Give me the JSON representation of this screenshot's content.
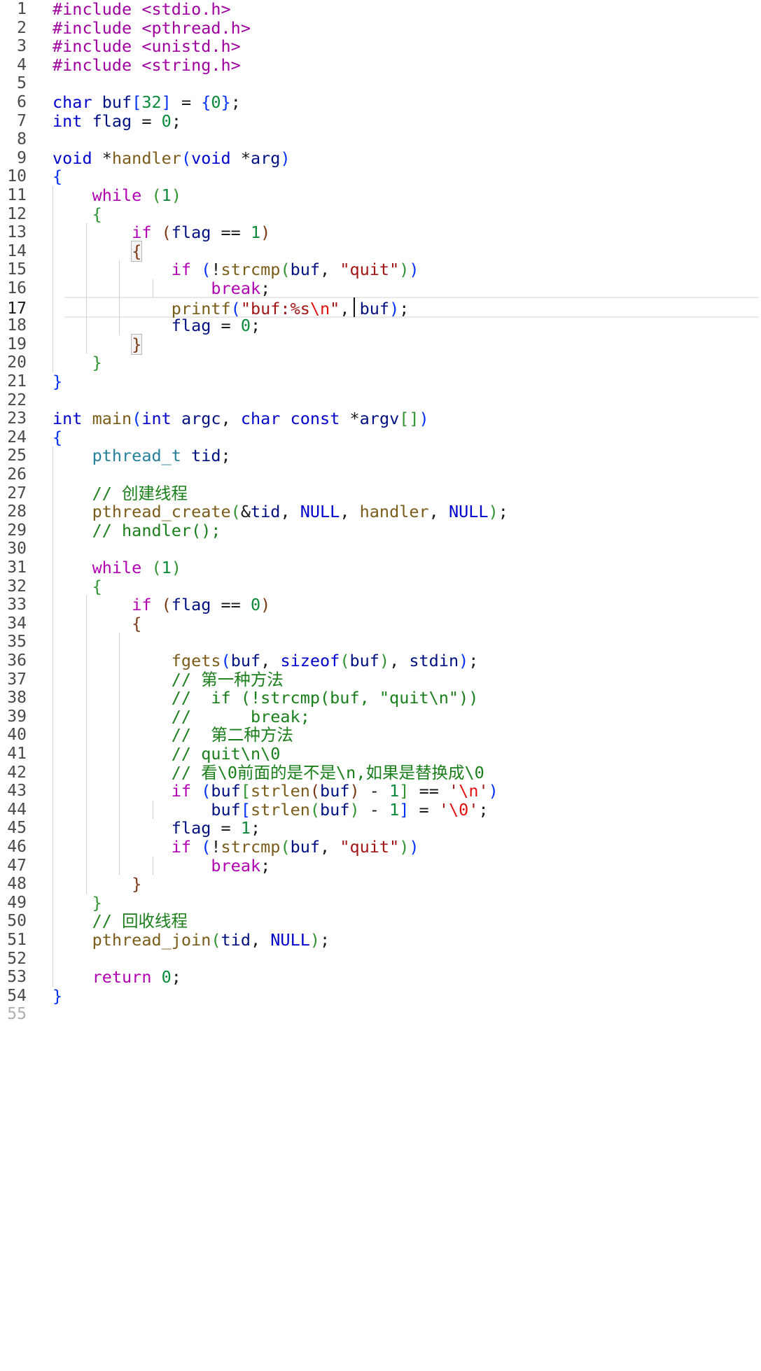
{
  "editor": {
    "language": "c",
    "current_line": 17,
    "lines": [
      {
        "n": "1",
        "t": [
          [
            "pp",
            "#include <stdio.h>"
          ]
        ]
      },
      {
        "n": "2",
        "t": [
          [
            "pp",
            "#include <pthread.h>"
          ]
        ]
      },
      {
        "n": "3",
        "t": [
          [
            "pp",
            "#include <unistd.h>"
          ]
        ]
      },
      {
        "n": "4",
        "t": [
          [
            "pp",
            "#include <string.h>"
          ]
        ]
      },
      {
        "n": "5",
        "t": []
      },
      {
        "n": "6",
        "t": [
          [
            "kw",
            "char"
          ],
          [
            "op",
            " "
          ],
          [
            "id",
            "buf"
          ],
          [
            "p1",
            "["
          ],
          [
            "num",
            "32"
          ],
          [
            "p1",
            "]"
          ],
          [
            "op",
            " = "
          ],
          [
            "p1",
            "{"
          ],
          [
            "num",
            "0"
          ],
          [
            "p1",
            "}"
          ],
          [
            "op",
            ";"
          ]
        ]
      },
      {
        "n": "7",
        "t": [
          [
            "kw",
            "int"
          ],
          [
            "op",
            " "
          ],
          [
            "id",
            "flag"
          ],
          [
            "op",
            " = "
          ],
          [
            "num",
            "0"
          ],
          [
            "op",
            ";"
          ]
        ]
      },
      {
        "n": "8",
        "t": []
      },
      {
        "n": "9",
        "t": [
          [
            "kw",
            "void"
          ],
          [
            "op",
            " *"
          ],
          [
            "fn",
            "handler"
          ],
          [
            "p1",
            "("
          ],
          [
            "kw",
            "void"
          ],
          [
            "op",
            " *"
          ],
          [
            "id",
            "arg"
          ],
          [
            "p1",
            ")"
          ]
        ]
      },
      {
        "n": "10",
        "t": [
          [
            "p1",
            "{"
          ]
        ]
      },
      {
        "n": "11",
        "t": [
          [
            "op",
            "    "
          ],
          [
            "ctl",
            "while"
          ],
          [
            "op",
            " "
          ],
          [
            "p2",
            "("
          ],
          [
            "num",
            "1"
          ],
          [
            "p2",
            ")"
          ]
        ]
      },
      {
        "n": "12",
        "t": [
          [
            "op",
            "    "
          ],
          [
            "p2",
            "{"
          ]
        ]
      },
      {
        "n": "13",
        "t": [
          [
            "op",
            "        "
          ],
          [
            "ctl",
            "if"
          ],
          [
            "op",
            " "
          ],
          [
            "p3",
            "("
          ],
          [
            "id",
            "flag"
          ],
          [
            "op",
            " == "
          ],
          [
            "num",
            "1"
          ],
          [
            "p3",
            ")"
          ]
        ]
      },
      {
        "n": "14",
        "t": [
          [
            "op",
            "        "
          ],
          [
            "p3b",
            "{"
          ]
        ]
      },
      {
        "n": "15",
        "t": [
          [
            "op",
            "            "
          ],
          [
            "ctl",
            "if"
          ],
          [
            "op",
            " "
          ],
          [
            "p1",
            "("
          ],
          [
            "op",
            "!"
          ],
          [
            "fn",
            "strcmp"
          ],
          [
            "p2",
            "("
          ],
          [
            "id",
            "buf"
          ],
          [
            "op",
            ", "
          ],
          [
            "str",
            "\"quit\""
          ],
          [
            "p2",
            ")"
          ],
          [
            "p1",
            ")"
          ]
        ]
      },
      {
        "n": "16",
        "t": [
          [
            "op",
            "                "
          ],
          [
            "ctl",
            "break"
          ],
          [
            "op",
            ";"
          ]
        ]
      },
      {
        "n": "17",
        "t": [
          [
            "op",
            "            "
          ],
          [
            "fn",
            "printf"
          ],
          [
            "p1",
            "("
          ],
          [
            "str",
            "\"buf:%s"
          ],
          [
            "esc",
            "\\n"
          ],
          [
            "str",
            "\""
          ],
          [
            "op",
            ", "
          ],
          [
            "id",
            "buf"
          ],
          [
            "p1",
            ")"
          ],
          [
            "op",
            ";"
          ]
        ]
      },
      {
        "n": "18",
        "t": [
          [
            "op",
            "            "
          ],
          [
            "id",
            "flag"
          ],
          [
            "op",
            " = "
          ],
          [
            "num",
            "0"
          ],
          [
            "op",
            ";"
          ]
        ]
      },
      {
        "n": "19",
        "t": [
          [
            "op",
            "        "
          ],
          [
            "p3b",
            "}"
          ]
        ]
      },
      {
        "n": "20",
        "t": [
          [
            "op",
            "    "
          ],
          [
            "p2",
            "}"
          ]
        ]
      },
      {
        "n": "21",
        "t": [
          [
            "p1",
            "}"
          ]
        ]
      },
      {
        "n": "22",
        "t": []
      },
      {
        "n": "23",
        "t": [
          [
            "kw",
            "int"
          ],
          [
            "op",
            " "
          ],
          [
            "fn",
            "main"
          ],
          [
            "p1",
            "("
          ],
          [
            "kw",
            "int"
          ],
          [
            "op",
            " "
          ],
          [
            "id",
            "argc"
          ],
          [
            "op",
            ", "
          ],
          [
            "kw",
            "char"
          ],
          [
            "op",
            " "
          ],
          [
            "kw",
            "const"
          ],
          [
            "op",
            " *"
          ],
          [
            "id",
            "argv"
          ],
          [
            "p2",
            "[]"
          ],
          [
            "p1",
            ")"
          ]
        ]
      },
      {
        "n": "24",
        "t": [
          [
            "p1",
            "{"
          ]
        ]
      },
      {
        "n": "25",
        "t": [
          [
            "op",
            "    "
          ],
          [
            "ty",
            "pthread_t"
          ],
          [
            "op",
            " "
          ],
          [
            "id",
            "tid"
          ],
          [
            "op",
            ";"
          ]
        ]
      },
      {
        "n": "26",
        "t": []
      },
      {
        "n": "27",
        "t": [
          [
            "op",
            "    "
          ],
          [
            "cm",
            "// 创建线程"
          ]
        ]
      },
      {
        "n": "28",
        "t": [
          [
            "op",
            "    "
          ],
          [
            "fn",
            "pthread_create"
          ],
          [
            "p2",
            "("
          ],
          [
            "op",
            "&"
          ],
          [
            "id",
            "tid"
          ],
          [
            "op",
            ", "
          ],
          [
            "kw",
            "NULL"
          ],
          [
            "op",
            ", "
          ],
          [
            "fn",
            "handler"
          ],
          [
            "op",
            ", "
          ],
          [
            "kw",
            "NULL"
          ],
          [
            "p2",
            ")"
          ],
          [
            "op",
            ";"
          ]
        ]
      },
      {
        "n": "29",
        "t": [
          [
            "op",
            "    "
          ],
          [
            "cm",
            "// handler();"
          ]
        ]
      },
      {
        "n": "30",
        "t": []
      },
      {
        "n": "31",
        "t": [
          [
            "op",
            "    "
          ],
          [
            "ctl",
            "while"
          ],
          [
            "op",
            " "
          ],
          [
            "p2",
            "("
          ],
          [
            "num",
            "1"
          ],
          [
            "p2",
            ")"
          ]
        ]
      },
      {
        "n": "32",
        "t": [
          [
            "op",
            "    "
          ],
          [
            "p2",
            "{"
          ]
        ]
      },
      {
        "n": "33",
        "t": [
          [
            "op",
            "        "
          ],
          [
            "ctl",
            "if"
          ],
          [
            "op",
            " "
          ],
          [
            "p3",
            "("
          ],
          [
            "id",
            "flag"
          ],
          [
            "op",
            " == "
          ],
          [
            "num",
            "0"
          ],
          [
            "p3",
            ")"
          ]
        ]
      },
      {
        "n": "34",
        "t": [
          [
            "op",
            "        "
          ],
          [
            "p3",
            "{"
          ]
        ]
      },
      {
        "n": "35",
        "t": []
      },
      {
        "n": "36",
        "t": [
          [
            "op",
            "            "
          ],
          [
            "fn",
            "fgets"
          ],
          [
            "p1",
            "("
          ],
          [
            "id",
            "buf"
          ],
          [
            "op",
            ", "
          ],
          [
            "kw",
            "sizeof"
          ],
          [
            "p2",
            "("
          ],
          [
            "id",
            "buf"
          ],
          [
            "p2",
            ")"
          ],
          [
            "op",
            ", "
          ],
          [
            "id",
            "stdin"
          ],
          [
            "p1",
            ")"
          ],
          [
            "op",
            ";"
          ]
        ]
      },
      {
        "n": "37",
        "t": [
          [
            "op",
            "            "
          ],
          [
            "cm",
            "// 第一种方法"
          ]
        ]
      },
      {
        "n": "38",
        "t": [
          [
            "op",
            "            "
          ],
          [
            "cm",
            "//  if (!strcmp(buf, \"quit\\n\"))"
          ]
        ]
      },
      {
        "n": "39",
        "t": [
          [
            "op",
            "            "
          ],
          [
            "cm",
            "//      break;"
          ]
        ]
      },
      {
        "n": "40",
        "t": [
          [
            "op",
            "            "
          ],
          [
            "cm",
            "//  第二种方法"
          ]
        ]
      },
      {
        "n": "41",
        "t": [
          [
            "op",
            "            "
          ],
          [
            "cm",
            "// quit\\n\\0"
          ]
        ]
      },
      {
        "n": "42",
        "t": [
          [
            "op",
            "            "
          ],
          [
            "cm",
            "// 看\\0前面的是不是\\n,如果是替换成\\0"
          ]
        ]
      },
      {
        "n": "43",
        "t": [
          [
            "op",
            "            "
          ],
          [
            "ctl",
            "if"
          ],
          [
            "op",
            " "
          ],
          [
            "p1",
            "("
          ],
          [
            "id",
            "buf"
          ],
          [
            "p2",
            "["
          ],
          [
            "fn",
            "strlen"
          ],
          [
            "p3",
            "("
          ],
          [
            "id",
            "buf"
          ],
          [
            "p3",
            ")"
          ],
          [
            "op",
            " - "
          ],
          [
            "num",
            "1"
          ],
          [
            "p2",
            "]"
          ],
          [
            "op",
            " == "
          ],
          [
            "str",
            "'"
          ],
          [
            "esc",
            "\\n"
          ],
          [
            "str",
            "'"
          ],
          [
            "p1",
            ")"
          ]
        ]
      },
      {
        "n": "44",
        "t": [
          [
            "op",
            "                "
          ],
          [
            "id",
            "buf"
          ],
          [
            "p1",
            "["
          ],
          [
            "fn",
            "strlen"
          ],
          [
            "p2",
            "("
          ],
          [
            "id",
            "buf"
          ],
          [
            "p2",
            ")"
          ],
          [
            "op",
            " - "
          ],
          [
            "num",
            "1"
          ],
          [
            "p1",
            "]"
          ],
          [
            "op",
            " = "
          ],
          [
            "str",
            "'"
          ],
          [
            "esc",
            "\\0"
          ],
          [
            "str",
            "'"
          ],
          [
            "op",
            ";"
          ]
        ]
      },
      {
        "n": "45",
        "t": [
          [
            "op",
            "            "
          ],
          [
            "id",
            "flag"
          ],
          [
            "op",
            " = "
          ],
          [
            "num",
            "1"
          ],
          [
            "op",
            ";"
          ]
        ]
      },
      {
        "n": "46",
        "t": [
          [
            "op",
            "            "
          ],
          [
            "ctl",
            "if"
          ],
          [
            "op",
            " "
          ],
          [
            "p1",
            "("
          ],
          [
            "op",
            "!"
          ],
          [
            "fn",
            "strcmp"
          ],
          [
            "p2",
            "("
          ],
          [
            "id",
            "buf"
          ],
          [
            "op",
            ", "
          ],
          [
            "str",
            "\"quit\""
          ],
          [
            "p2",
            ")"
          ],
          [
            "p1",
            ")"
          ]
        ]
      },
      {
        "n": "47",
        "t": [
          [
            "op",
            "                "
          ],
          [
            "ctl",
            "break"
          ],
          [
            "op",
            ";"
          ]
        ]
      },
      {
        "n": "48",
        "t": [
          [
            "op",
            "        "
          ],
          [
            "p3",
            "}"
          ]
        ]
      },
      {
        "n": "49",
        "t": [
          [
            "op",
            "    "
          ],
          [
            "p2",
            "}"
          ]
        ]
      },
      {
        "n": "50",
        "t": [
          [
            "op",
            "    "
          ],
          [
            "cm",
            "// 回收线程"
          ]
        ]
      },
      {
        "n": "51",
        "t": [
          [
            "op",
            "    "
          ],
          [
            "fn",
            "pthread_join"
          ],
          [
            "p2",
            "("
          ],
          [
            "id",
            "tid"
          ],
          [
            "op",
            ", "
          ],
          [
            "kw",
            "NULL"
          ],
          [
            "p2",
            ")"
          ],
          [
            "op",
            ";"
          ]
        ]
      },
      {
        "n": "52",
        "t": []
      },
      {
        "n": "53",
        "t": [
          [
            "op",
            "    "
          ],
          [
            "ctl",
            "return"
          ],
          [
            "op",
            " "
          ],
          [
            "num",
            "0"
          ],
          [
            "op",
            ";"
          ]
        ]
      },
      {
        "n": "54",
        "t": [
          [
            "p1",
            "}"
          ]
        ]
      },
      {
        "n": "55",
        "t": []
      }
    ]
  }
}
